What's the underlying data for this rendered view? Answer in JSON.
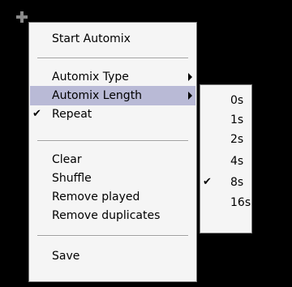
{
  "colors": {
    "background": "#000000",
    "menu_background": "#f5f5f5",
    "highlight": "#b9bad6",
    "border": "#7a7a7a"
  },
  "grip_icon": "plus-grip-icon",
  "main_menu": {
    "start_automix": "Start Automix",
    "automix_type": "Automix Type",
    "automix_length": "Automix Length",
    "repeat": "Repeat",
    "repeat_check": "✔",
    "clear": "Clear",
    "shuffle": "Shuffle",
    "remove_played": "Remove played",
    "remove_duplicates": "Remove duplicates",
    "save": "Save"
  },
  "submenu": {
    "items": [
      "0s",
      "1s",
      "2s",
      "4s",
      "8s",
      "16s"
    ],
    "check": "✔",
    "selected": "8s"
  }
}
